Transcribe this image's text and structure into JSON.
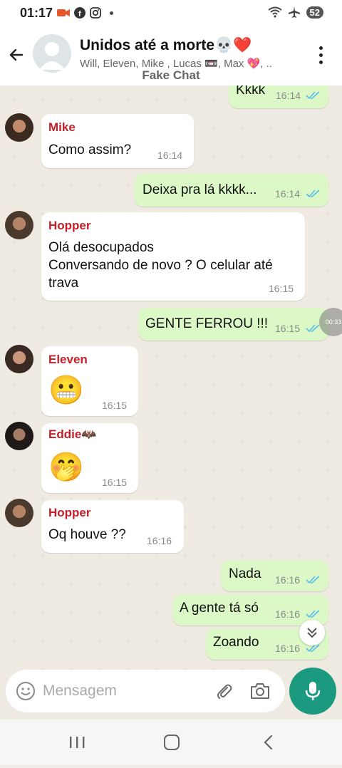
{
  "status_bar": {
    "time": "01:17",
    "battery": "52"
  },
  "header": {
    "title": "Unidos até a morte💀❤️",
    "members": "Will, Eleven, Mike , Lucas 📼, Max 💖, ..",
    "overlay_label": "Fake Chat"
  },
  "messages": [
    {
      "direction": "out",
      "text": "Kkkk",
      "time": "16:14",
      "read": true
    },
    {
      "direction": "in",
      "sender": "Mike",
      "text": "Como assim?",
      "time": "16:14"
    },
    {
      "direction": "out",
      "text": "Deixa pra lá kkkk...",
      "time": "16:14",
      "read": true
    },
    {
      "direction": "in",
      "sender": "Hopper",
      "text_lines": [
        "Olá desocupados",
        "Conversando de novo ? O celular até",
        "trava"
      ],
      "time": "16:15"
    },
    {
      "direction": "out",
      "text": "GENTE FERROU !!!",
      "time": "16:15",
      "read": true
    },
    {
      "direction": "in",
      "sender": "Eleven",
      "emoji": "😬",
      "time": "16:15"
    },
    {
      "direction": "in",
      "sender": "Eddie🦇",
      "emoji": "🤭",
      "time": "16:15"
    },
    {
      "direction": "in",
      "sender": "Hopper",
      "text": "Oq houve ??",
      "time": "16:16"
    },
    {
      "direction": "out",
      "text": "Nada",
      "time": "16:16",
      "read": true
    },
    {
      "direction": "out",
      "text": "A gente tá só",
      "time": "16:16",
      "read": true
    },
    {
      "direction": "out",
      "text": "Zoando",
      "time": "16:16",
      "read": true
    }
  ],
  "floating_timer": "00:33",
  "composer": {
    "placeholder": "Mensagem"
  },
  "colors": {
    "accent": "#1c9a80",
    "outgoing_bubble": "#dcf8c6",
    "sender_name": "#c3202a",
    "read_tick": "#53bdeb"
  }
}
